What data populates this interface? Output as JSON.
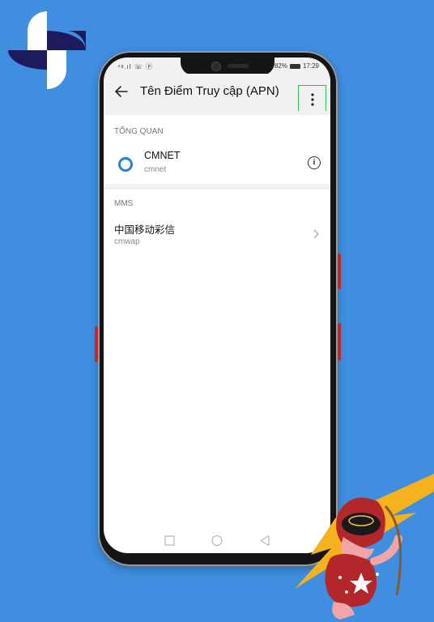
{
  "statusbar": {
    "left_icons": "⁴ᵍ.ıl ☏ ⓟ",
    "battery_percent": "82%",
    "time": "17:29"
  },
  "toolbar": {
    "title": "Tên Điểm Truy cập (APN)"
  },
  "sections": {
    "overview": "TỔNG QUAN",
    "mms": "MMS"
  },
  "apns": [
    {
      "name": "CMNET",
      "apn": "cmnet",
      "selected": true
    },
    {
      "name": "中国移动彩信",
      "apn": "cmwap"
    }
  ],
  "colors": {
    "background": "#3f8ee0",
    "accent": "#2a7ce0",
    "highlight_box": "#2fbb5a"
  }
}
